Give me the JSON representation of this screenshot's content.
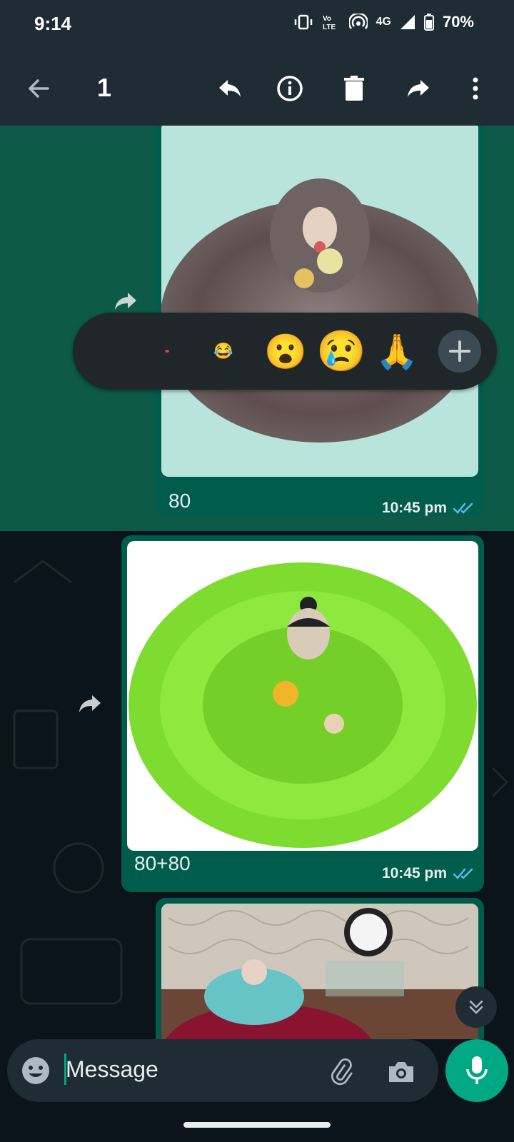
{
  "status_bar": {
    "time": "9:14",
    "network": "4G",
    "battery": "70%"
  },
  "toolbar": {
    "selected_count": "1"
  },
  "messages": [
    {
      "caption": "80",
      "time": "10:45 pm",
      "status": "read"
    },
    {
      "caption": "80+80",
      "time": "10:45 pm",
      "status": "read"
    },
    {
      "caption": "",
      "time": "",
      "status": ""
    }
  ],
  "reactions": [
    "😂",
    "😮",
    "😢",
    "🙏"
  ],
  "composer": {
    "placeholder": "Message"
  },
  "colors": {
    "accent": "#00a884",
    "bubble_out": "#005c4b",
    "read_ticks": "#53bdeb",
    "header": "#1f2c34",
    "selection_overlay": "#0e5a48"
  }
}
